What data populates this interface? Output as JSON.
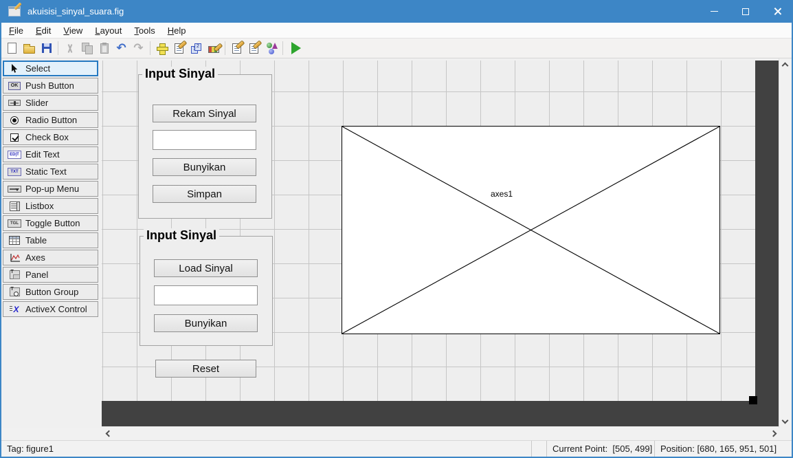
{
  "window": {
    "title": "akuisisi_sinyal_suara.fig",
    "controls": {
      "minimize": "minimize",
      "maximize": "maximize",
      "close": "close"
    },
    "accent_color": "#3d86c6"
  },
  "menubar": {
    "items": [
      {
        "label": "File"
      },
      {
        "label": "Edit"
      },
      {
        "label": "View"
      },
      {
        "label": "Layout"
      },
      {
        "label": "Tools"
      },
      {
        "label": "Help"
      }
    ]
  },
  "toolbar": {
    "buttons": [
      {
        "icon": "new-figure-icon",
        "enabled": true
      },
      {
        "icon": "open-folder-icon",
        "enabled": true
      },
      {
        "icon": "save-icon",
        "enabled": true
      },
      {
        "icon": "cut-icon",
        "enabled": false
      },
      {
        "icon": "copy-icon",
        "enabled": false
      },
      {
        "icon": "paste-icon",
        "enabled": false
      },
      {
        "icon": "undo-icon",
        "enabled": true
      },
      {
        "icon": "redo-icon",
        "enabled": false
      },
      {
        "icon": "align-objects-icon",
        "enabled": true
      },
      {
        "icon": "menu-editor-icon",
        "enabled": true
      },
      {
        "icon": "tab-order-editor-icon",
        "enabled": true
      },
      {
        "icon": "toolbar-editor-icon",
        "enabled": true
      },
      {
        "icon": "m-file-editor-icon",
        "enabled": true
      },
      {
        "icon": "property-inspector-icon",
        "enabled": true
      },
      {
        "icon": "object-browser-icon",
        "enabled": true
      },
      {
        "icon": "run-figure-icon",
        "enabled": true
      }
    ]
  },
  "palette": {
    "items": [
      {
        "label": "Select",
        "icon": "cursor-icon",
        "selected": true
      },
      {
        "label": "Push Button",
        "icon": "push-button-icon",
        "icon_text": "OK",
        "selected": false
      },
      {
        "label": "Slider",
        "icon": "slider-icon",
        "selected": false
      },
      {
        "label": "Radio Button",
        "icon": "radio-button-icon",
        "selected": false
      },
      {
        "label": "Check Box",
        "icon": "check-box-icon",
        "selected": false
      },
      {
        "label": "Edit Text",
        "icon": "edit-text-icon",
        "icon_text": "ED|T",
        "selected": false
      },
      {
        "label": "Static Text",
        "icon": "static-text-icon",
        "icon_text": "TXT",
        "selected": false
      },
      {
        "label": "Pop-up Menu",
        "icon": "popup-menu-icon",
        "selected": false
      },
      {
        "label": "Listbox",
        "icon": "listbox-icon",
        "selected": false
      },
      {
        "label": "Toggle Button",
        "icon": "toggle-button-icon",
        "icon_text": "TGL",
        "selected": false
      },
      {
        "label": "Table",
        "icon": "table-icon",
        "selected": false
      },
      {
        "label": "Axes",
        "icon": "axes-icon",
        "selected": false
      },
      {
        "label": "Panel",
        "icon": "panel-icon",
        "icon_text": "T",
        "selected": false
      },
      {
        "label": "Button Group",
        "icon": "button-group-icon",
        "icon_text": "T",
        "selected": false
      },
      {
        "label": "ActiveX Control",
        "icon": "activex-icon",
        "icon_text": "X",
        "selected": false
      }
    ]
  },
  "canvas": {
    "panel_record": {
      "title": "Input Sinyal",
      "record_button": "Rekam Sinyal",
      "edit_value": "",
      "play_button": "Bunyikan",
      "save_button": "Simpan"
    },
    "panel_load": {
      "title": "Input Sinyal",
      "load_button": "Load Sinyal",
      "edit_value": "",
      "play_button": "Bunyikan"
    },
    "reset_button": "Reset",
    "axes_label": "axes1"
  },
  "statusbar": {
    "tag": "Tag: figure1",
    "current_point": "Current Point:  [505, 499]",
    "position": "Position: [680, 165, 951, 501]"
  }
}
